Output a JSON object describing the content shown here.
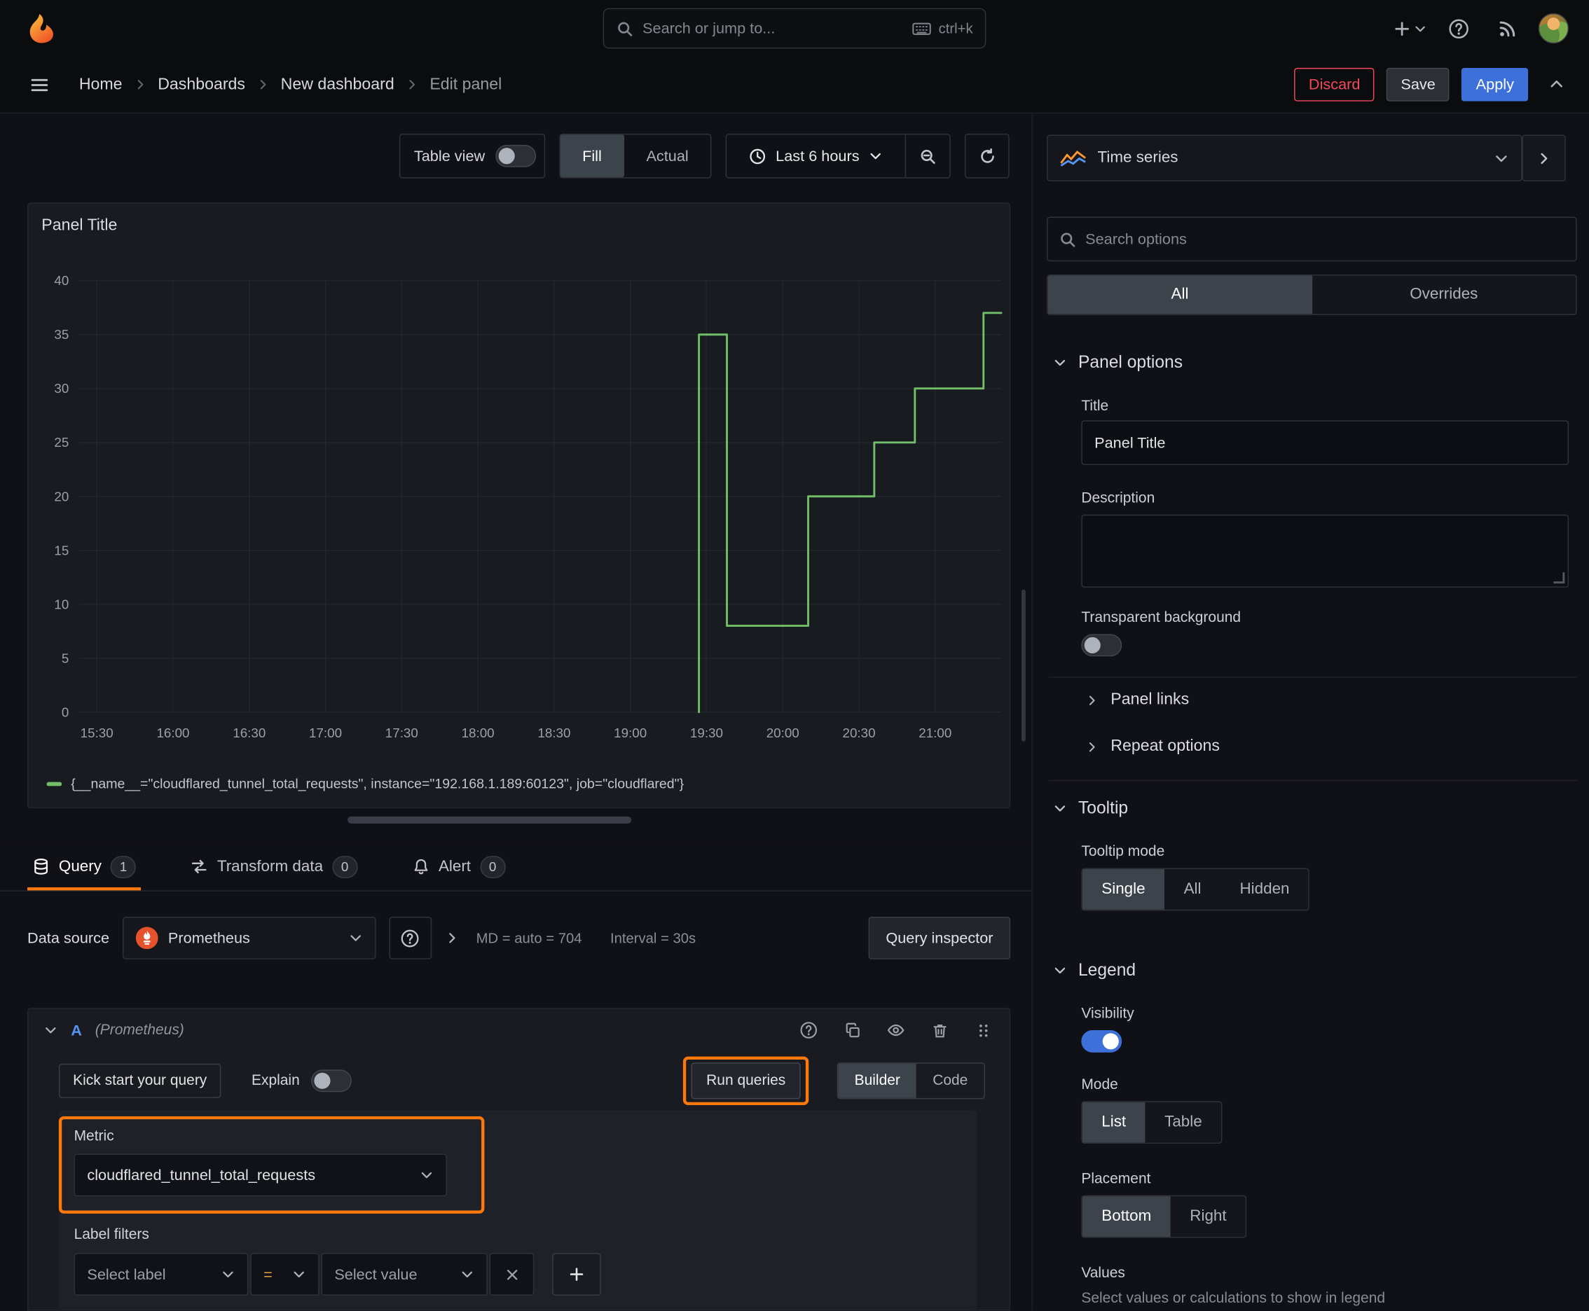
{
  "colors": {
    "accent_blue": "#3d71d9",
    "highlight_orange": "#ff780a",
    "discard_red": "#f2495c",
    "series_green": "#73bf69"
  },
  "header": {
    "search_placeholder": "Search or jump to...",
    "search_shortcut": "ctrl+k"
  },
  "breadcrumb": {
    "items": [
      "Home",
      "Dashboards",
      "New dashboard",
      "Edit panel"
    ],
    "discard_label": "Discard",
    "save_label": "Save",
    "apply_label": "Apply"
  },
  "toolbar": {
    "table_view_label": "Table view",
    "fill_label": "Fill",
    "actual_label": "Actual",
    "time_range_label": "Last 6 hours"
  },
  "panel": {
    "title": "Panel Title"
  },
  "chart_data": {
    "type": "line",
    "title": "Panel Title",
    "x_start": "15:23",
    "x_end": "21:26",
    "x_ticks": [
      "15:30",
      "16:00",
      "16:30",
      "17:00",
      "17:30",
      "18:00",
      "18:30",
      "19:00",
      "19:30",
      "20:00",
      "20:30",
      "21:00"
    ],
    "y_ticks": [
      0,
      5,
      10,
      15,
      20,
      25,
      30,
      35,
      40
    ],
    "ylim": [
      0,
      40
    ],
    "grid": true,
    "legend_position": "bottom",
    "series": [
      {
        "name": "{__name__=\"cloudflared_tunnel_total_requests\", instance=\"192.168.1.189:60123\", job=\"cloudflared\"}",
        "color": "#73bf69",
        "points": [
          {
            "t": "19:27",
            "v": 0
          },
          {
            "t": "19:27",
            "v": 35
          },
          {
            "t": "19:38",
            "v": 35
          },
          {
            "t": "19:38",
            "v": 8
          },
          {
            "t": "20:10",
            "v": 8
          },
          {
            "t": "20:10",
            "v": 20
          },
          {
            "t": "20:36",
            "v": 20
          },
          {
            "t": "20:36",
            "v": 25
          },
          {
            "t": "20:52",
            "v": 25
          },
          {
            "t": "20:52",
            "v": 30
          },
          {
            "t": "21:19",
            "v": 30
          },
          {
            "t": "21:19",
            "v": 37
          },
          {
            "t": "21:26",
            "v": 37
          }
        ]
      }
    ]
  },
  "tabs": {
    "query_label": "Query",
    "query_count": "1",
    "transform_label": "Transform data",
    "transform_count": "0",
    "alert_label": "Alert",
    "alert_count": "0"
  },
  "query": {
    "datasource_label": "Data source",
    "datasource_value": "Prometheus",
    "stats_md": "MD = auto = 704",
    "stats_interval": "Interval = 30s",
    "inspector_label": "Query inspector",
    "ref_id": "A",
    "ref_datasource": "(Prometheus)",
    "kickstart_label": "Kick start your query",
    "explain_label": "Explain",
    "run_label": "Run queries",
    "builder_label": "Builder",
    "code_label": "Code",
    "metric_label": "Metric",
    "metric_value": "cloudflared_tunnel_total_requests",
    "label_filters_label": "Label filters",
    "select_label_placeholder": "Select label",
    "operator_value": "=",
    "select_value_placeholder": "Select value"
  },
  "options_pane": {
    "viz_label": "Time series",
    "search_placeholder": "Search options",
    "tab_all": "All",
    "tab_overrides": "Overrides",
    "panel_options_label": "Panel options",
    "title_label": "Title",
    "title_value": "Panel Title",
    "description_label": "Description",
    "transparent_label": "Transparent background",
    "panel_links_label": "Panel links",
    "repeat_options_label": "Repeat options",
    "tooltip_label": "Tooltip",
    "tooltip_mode_label": "Tooltip mode",
    "tooltip_modes": [
      "Single",
      "All",
      "Hidden"
    ],
    "legend_label": "Legend",
    "visibility_label": "Visibility",
    "mode_label": "Mode",
    "modes": [
      "List",
      "Table"
    ],
    "placement_label": "Placement",
    "placements": [
      "Bottom",
      "Right"
    ],
    "values_label": "Values",
    "values_help": "Select values or calculations to show in legend"
  },
  "icons": [
    "grafana-logo",
    "search",
    "keyboard",
    "plus",
    "chevron-down",
    "chevron-right",
    "chevron-up",
    "help-circle",
    "rss",
    "avatar",
    "menu",
    "clock",
    "zoom-out",
    "refresh",
    "database",
    "transform",
    "bell",
    "prometheus-logo",
    "question-circle",
    "copy",
    "eye",
    "trash",
    "drag-handle",
    "time-series-viz",
    "close"
  ]
}
